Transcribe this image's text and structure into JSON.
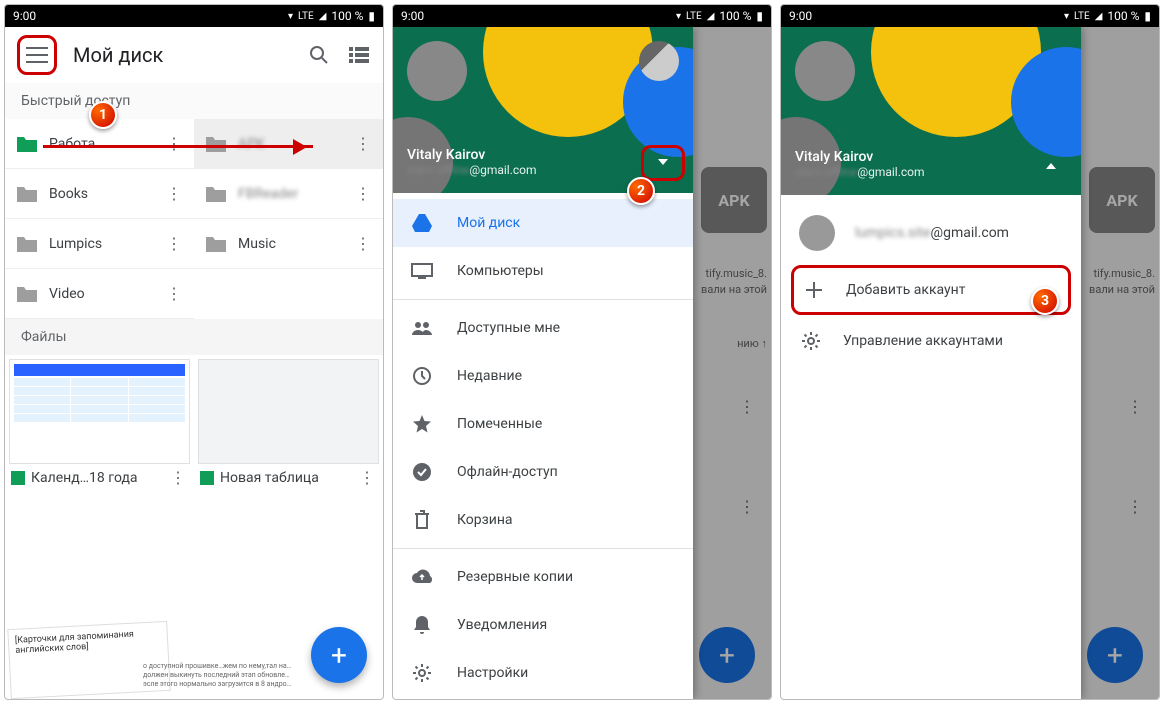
{
  "statusbar": {
    "time": "9:00",
    "battery": "100 %",
    "lte": "LTE"
  },
  "screen1": {
    "title": "Мой диск",
    "quick": "Быстрый доступ",
    "filesLabel": "Файлы",
    "folders": [
      {
        "name": "Работа",
        "color": "#0f9d58"
      },
      {
        "name": "APK",
        "color": "#9e9e9e",
        "selected": true,
        "blur": true
      },
      {
        "name": "Books",
        "color": "#9e9e9e"
      },
      {
        "name": "FBReader",
        "color": "#9e9e9e",
        "blur": true
      },
      {
        "name": "Lumpics",
        "color": "#9e9e9e"
      },
      {
        "name": "Music",
        "color": "#9e9e9e"
      },
      {
        "name": "Video",
        "color": "#9e9e9e"
      }
    ],
    "file1": "Календ…18 года",
    "file2": "Новая таблица",
    "card": "[Карточки для запоминания английских слов]",
    "blurtext": "о доступной прошивке…жем по нему,тал на… должен выкинуть последний этап обновле… эсле этого нормально загрузится в 8 андро…"
  },
  "account": {
    "name": "Vitaly Kairov",
    "email": "@gmail.com",
    "email_blur": "slam.offline"
  },
  "drawer": {
    "items": [
      {
        "icon": "drive",
        "label": "Мой диск",
        "active": true
      },
      {
        "icon": "computer",
        "label": "Компьютеры"
      },
      {
        "icon": "people",
        "label": "Доступные мне"
      },
      {
        "icon": "clock",
        "label": "Недавние"
      },
      {
        "icon": "star",
        "label": "Помеченные"
      },
      {
        "icon": "offline",
        "label": "Офлайн-доступ"
      },
      {
        "icon": "trash",
        "label": "Корзина"
      },
      {
        "icon": "backup",
        "label": "Резервные копии"
      },
      {
        "icon": "bell",
        "label": "Уведомления"
      },
      {
        "icon": "gear",
        "label": "Настройки"
      }
    ]
  },
  "bg": {
    "apk": "APK",
    "line1": "tify.music_8.",
    "line2": "вали на этой",
    "line3": "нию ↑"
  },
  "acctPanel": {
    "other_email": "@gmail.com",
    "other_blur": "lumpics.site",
    "add": "Добавить аккаунт",
    "manage": "Управление аккаунтами"
  },
  "steps": {
    "s1": "1",
    "s2": "2",
    "s3": "3"
  }
}
